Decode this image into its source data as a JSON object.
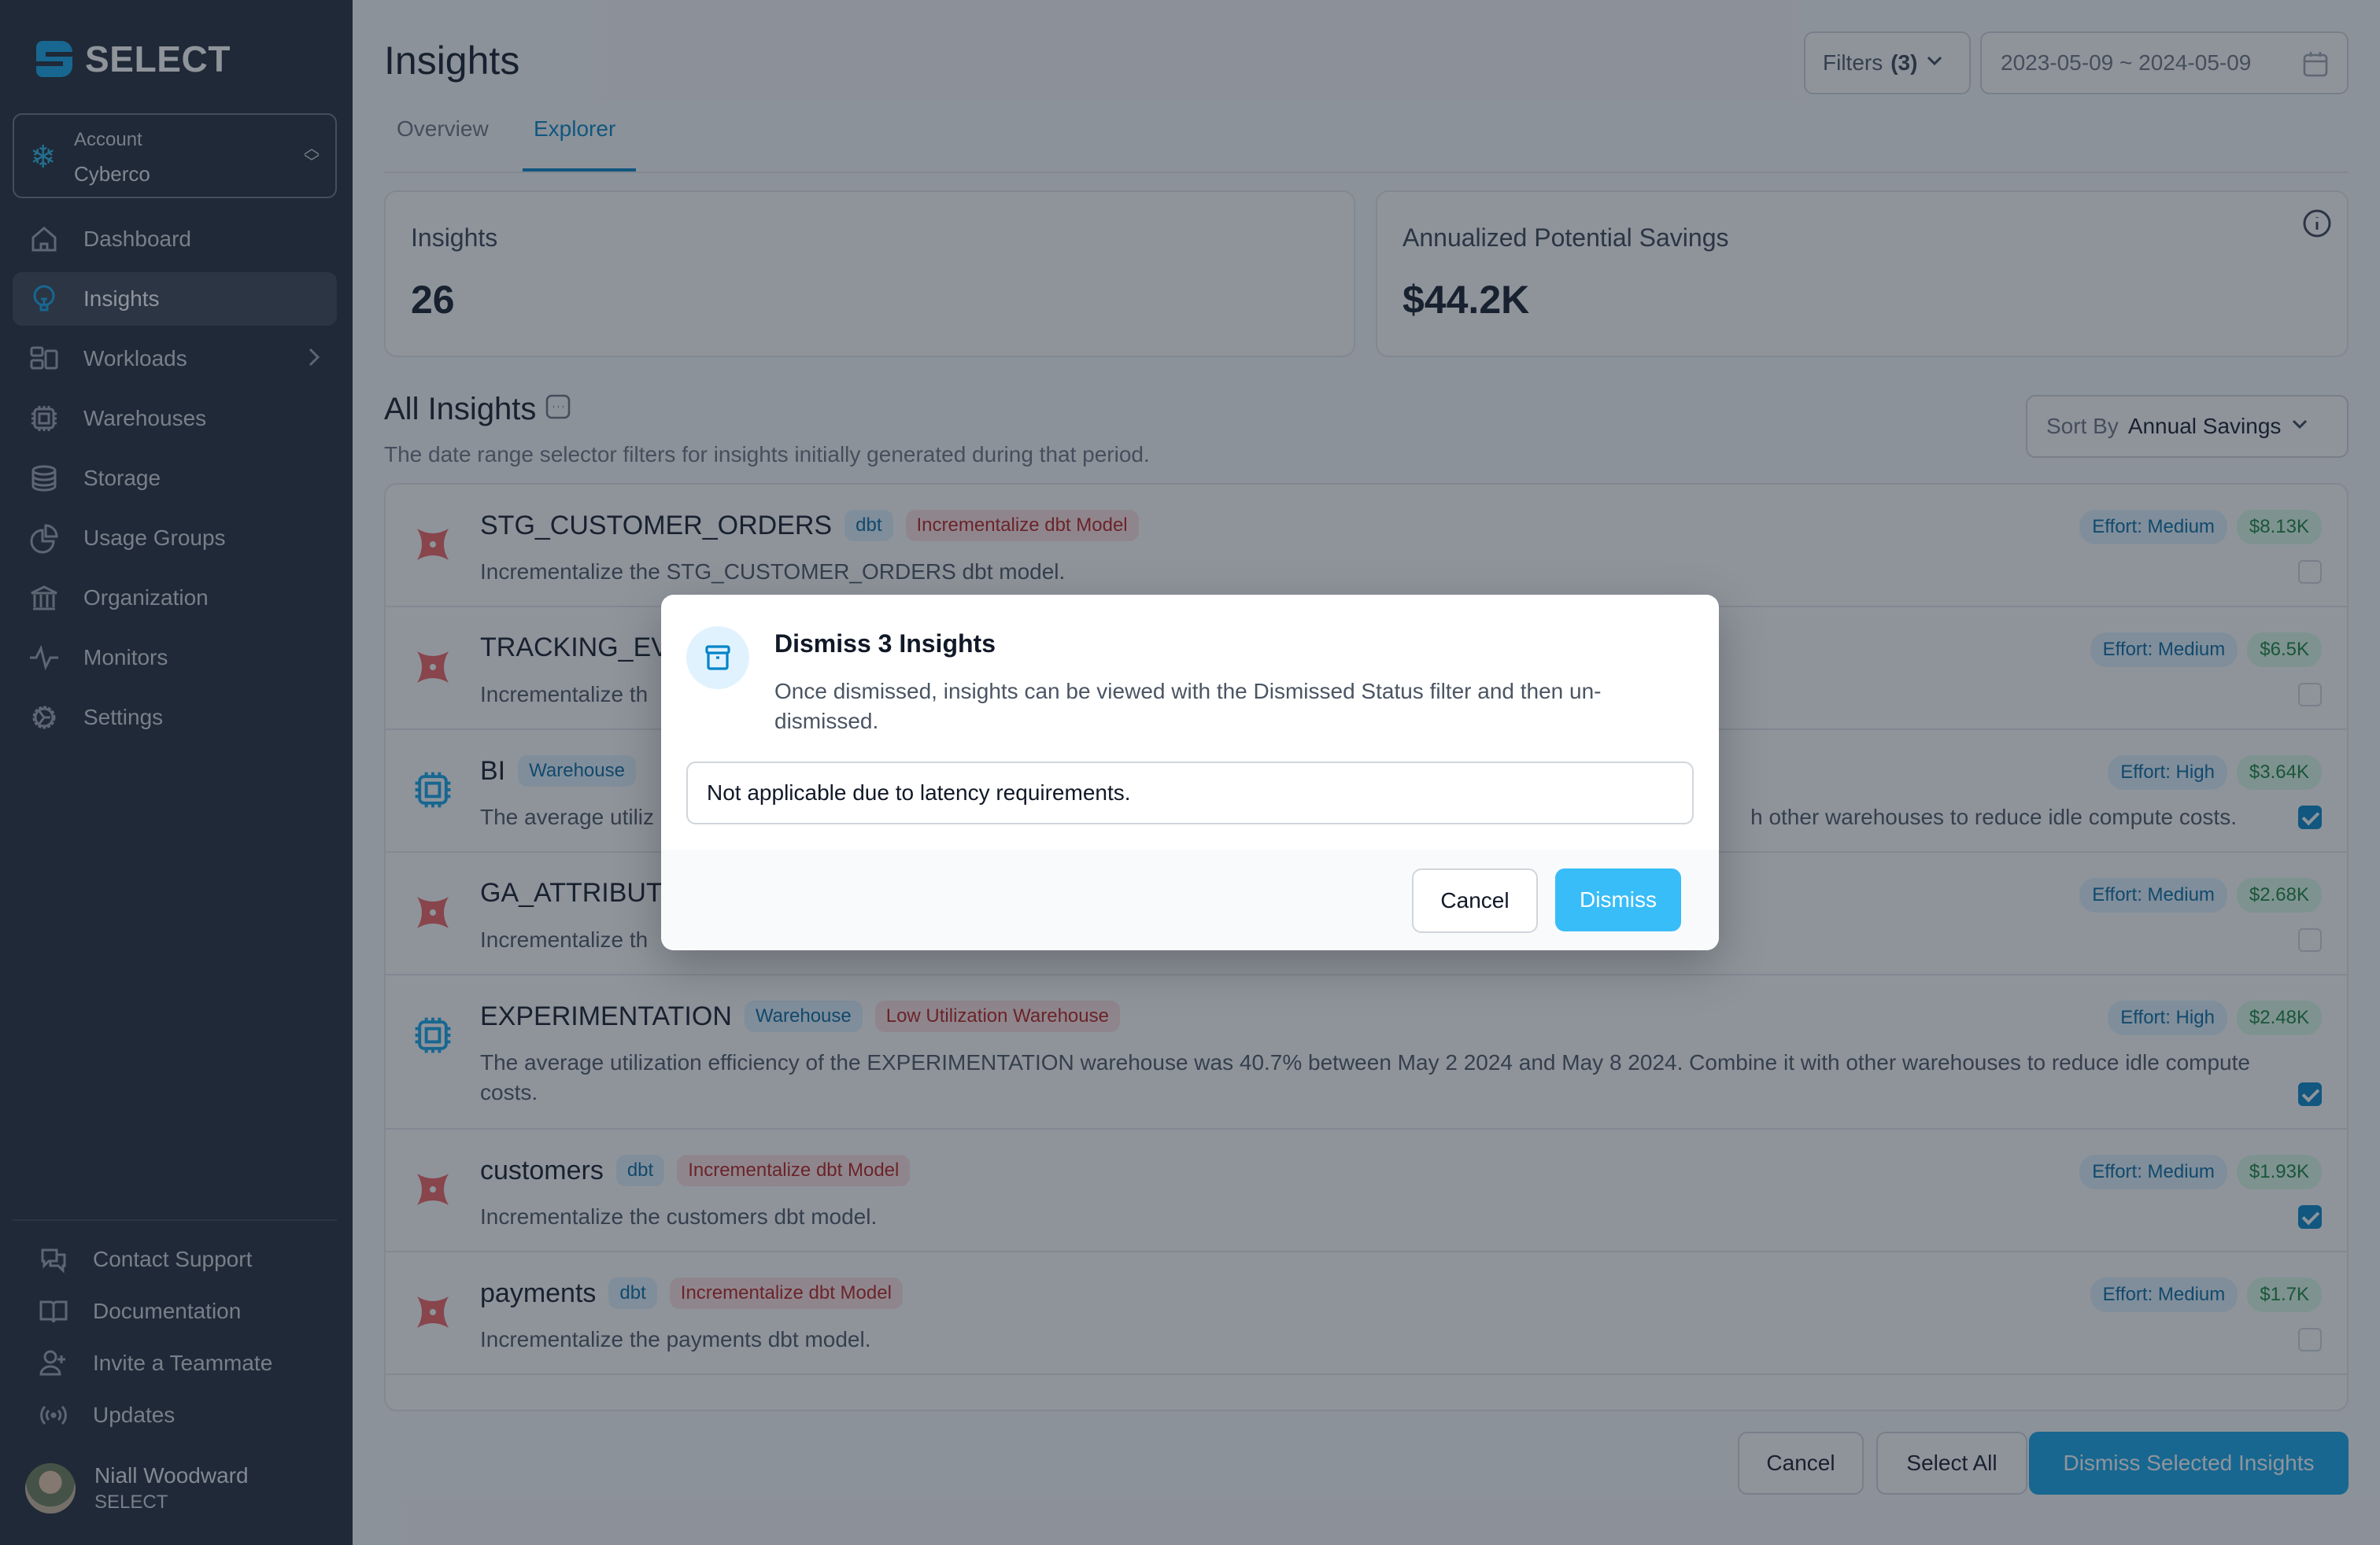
{
  "sidebar": {
    "brand": "SELECT",
    "account": {
      "label": "Account",
      "value": "Cyberco"
    },
    "nav": [
      {
        "label": "Dashboard",
        "icon": "home-icon"
      },
      {
        "label": "Insights",
        "icon": "lightbulb-icon",
        "active": true
      },
      {
        "label": "Workloads",
        "icon": "layout-icon",
        "has_submenu": true
      },
      {
        "label": "Warehouses",
        "icon": "cpu-chip-icon"
      },
      {
        "label": "Storage",
        "icon": "database-icon"
      },
      {
        "label": "Usage Groups",
        "icon": "pie-chart-icon"
      },
      {
        "label": "Organization",
        "icon": "bank-building-icon"
      },
      {
        "label": "Monitors",
        "icon": "pulse-icon"
      },
      {
        "label": "Settings",
        "icon": "gear-icon"
      }
    ],
    "footer_nav": [
      {
        "label": "Contact Support",
        "icon": "chat-bubbles-icon"
      },
      {
        "label": "Documentation",
        "icon": "book-icon"
      },
      {
        "label": "Invite a Teammate",
        "icon": "user-plus-icon"
      },
      {
        "label": "Updates",
        "icon": "broadcast-icon"
      }
    ],
    "user": {
      "name": "Niall Woodward",
      "org": "SELECT"
    }
  },
  "header": {
    "title": "Insights",
    "filters_label": "Filters",
    "filters_count": "(3)",
    "date_range": "2023-05-09 ~ 2024-05-09",
    "tabs": [
      {
        "label": "Overview"
      },
      {
        "label": "Explorer",
        "active": true
      }
    ]
  },
  "summary": {
    "insights_label": "Insights",
    "insights_value": "26",
    "savings_label": "Annualized Potential Savings",
    "savings_value": "$44.2K"
  },
  "all_insights": {
    "title": "All Insights",
    "subtitle": "The date range selector filters for insights initially generated during that period.",
    "sort_label": "Sort By",
    "sort_value": "Annual Savings",
    "rows": [
      {
        "name": "STG_CUSTOMER_ORDERS",
        "source": "dbt",
        "type": "Incrementalize dbt Model",
        "description": "Incrementalize the STG_CUSTOMER_ORDERS dbt model.",
        "effort": "Effort: Medium",
        "savings": "$8.13K",
        "checked": false,
        "icon": "dbt-icon"
      },
      {
        "name": "TRACKING_EVE",
        "source": "",
        "type": "",
        "description": "Incrementalize th",
        "effort": "Effort: Medium",
        "savings": "$6.5K",
        "checked": false,
        "icon": "dbt-icon"
      },
      {
        "name": "BI",
        "source": "Warehouse",
        "type": "",
        "description": "The average utiliz",
        "description_tail": "h other warehouses to reduce idle compute costs.",
        "effort": "Effort: High",
        "savings": "$3.64K",
        "checked": true,
        "icon": "warehouse-chip-icon"
      },
      {
        "name": "GA_ATTRIBUTI",
        "source": "",
        "type": "",
        "description": "Incrementalize th",
        "effort": "Effort: Medium",
        "savings": "$2.68K",
        "checked": false,
        "icon": "dbt-icon"
      },
      {
        "name": "EXPERIMENTATION",
        "source": "Warehouse",
        "type": "Low Utilization Warehouse",
        "description": "The average utilization efficiency of the EXPERIMENTATION warehouse was 40.7% between May 2 2024 and May 8 2024. Combine it with other warehouses to reduce idle compute costs.",
        "effort": "Effort: High",
        "savings": "$2.48K",
        "checked": true,
        "icon": "warehouse-chip-icon"
      },
      {
        "name": "customers",
        "source": "dbt",
        "type": "Incrementalize dbt Model",
        "description": "Incrementalize the customers dbt model.",
        "effort": "Effort: Medium",
        "savings": "$1.93K",
        "checked": true,
        "icon": "dbt-icon"
      },
      {
        "name": "payments",
        "source": "dbt",
        "type": "Incrementalize dbt Model",
        "description": "Incrementalize the payments dbt model.",
        "effort": "Effort: Medium",
        "savings": "$1.7K",
        "checked": false,
        "icon": "dbt-icon"
      }
    ]
  },
  "bulk_actions": {
    "cancel": "Cancel",
    "select_all": "Select All",
    "dismiss_selected": "Dismiss Selected Insights"
  },
  "modal": {
    "title": "Dismiss 3 Insights",
    "text": "Once dismissed, insights can be viewed with the Dismissed Status filter and then un-dismissed.",
    "input_value": "Not applicable due to latency requirements.",
    "cancel": "Cancel",
    "dismiss": "Dismiss"
  },
  "colors": {
    "accent": "#0ea5e9",
    "sidebar_bg": "#1f2937",
    "dismiss_button": "#38bdf8"
  }
}
